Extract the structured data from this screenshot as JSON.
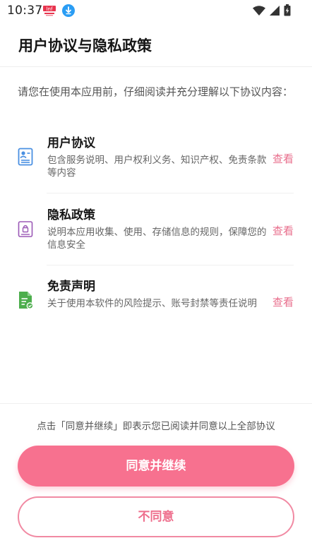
{
  "status_bar": {
    "time": "10:37",
    "app_icon": "shopping-app-icon",
    "download_icon": "download-icon",
    "wifi_icon": "wifi-icon",
    "signal_icon": "signal-icon",
    "battery_icon": "battery-charging-icon"
  },
  "header": {
    "title": "用户协议与隐私政策"
  },
  "intro": {
    "text": "请您在使用本应用前，仔细阅读并充分理解以下协议内容："
  },
  "agreements": [
    {
      "title": "用户协议",
      "description": "包含服务说明、用户权利义务、知识产权、免责条款等内容",
      "link_label": "查看",
      "icon": "user-agreement-icon",
      "icon_color": "#4a90e2"
    },
    {
      "title": "隐私政策",
      "description": "说明本应用收集、使用、存储信息的规则，保障您的信息安全",
      "link_label": "查看",
      "icon": "privacy-lock-icon",
      "icon_color": "#9b59b6"
    },
    {
      "title": "免责声明",
      "description": "关于使用本软件的风险提示、账号封禁等责任说明",
      "link_label": "查看",
      "icon": "disclaimer-document-icon",
      "icon_color": "#4cae4c"
    }
  ],
  "footer": {
    "note": "点击「同意并继续」即表示您已阅读并同意以上全部协议",
    "agree_label": "同意并继续",
    "disagree_label": "不同意"
  },
  "colors": {
    "accent": "#f7718f",
    "link": "#e86e8c",
    "outline": "#f18aa3"
  }
}
